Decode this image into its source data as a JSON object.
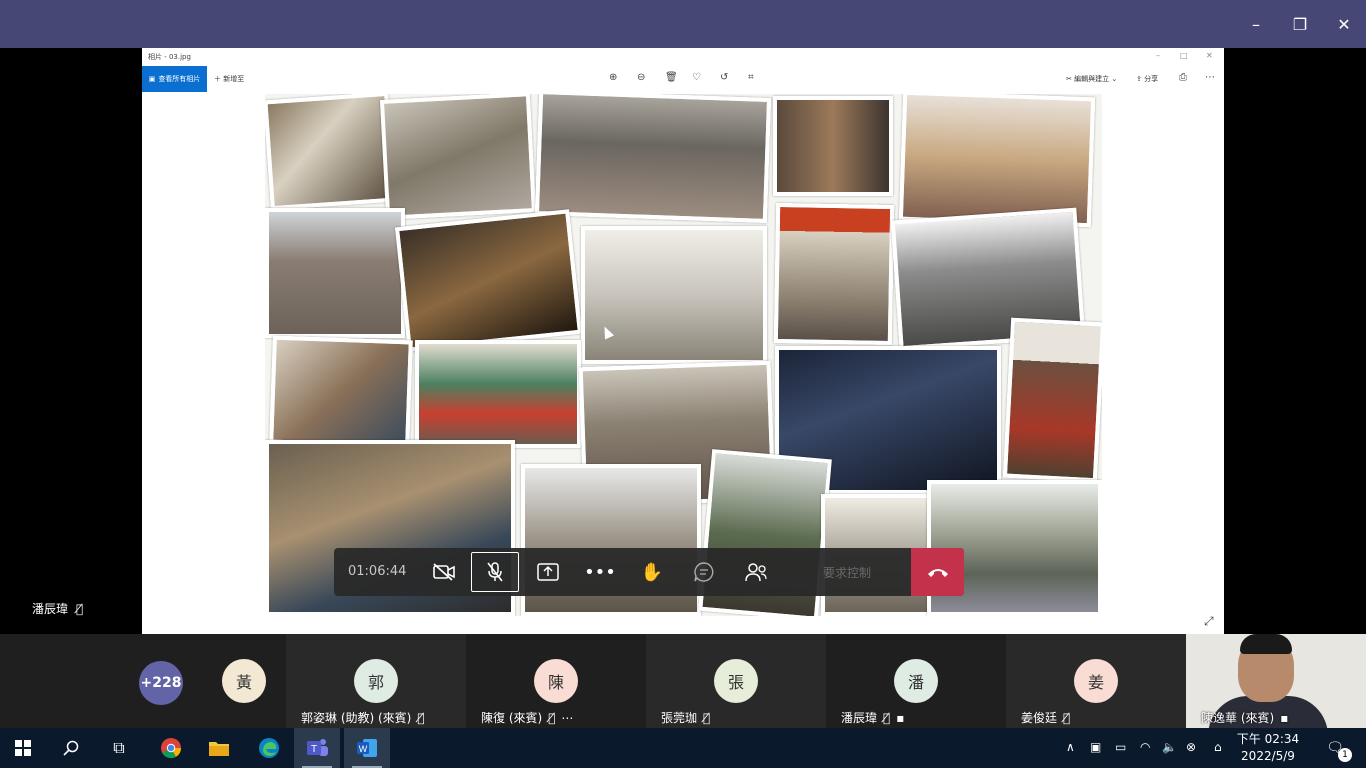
{
  "window": {
    "minimize_glyph": "–",
    "maximize_glyph": "❐",
    "close_glyph": "✕"
  },
  "photos_app": {
    "title": "相片 - 03.jpg",
    "tab_label": "查看所有相片",
    "add_label": "新增至",
    "edit_label": "編輯與建立",
    "share_label": "分享"
  },
  "presenter": {
    "name": "潘辰瑋"
  },
  "call": {
    "timer": "01:06:44",
    "request_control_label": "要求控制"
  },
  "participants": {
    "overflow_count": "+228",
    "items": [
      {
        "initial": "黃",
        "name": "",
        "color": "#f2e8d4"
      },
      {
        "initial": "郭",
        "name": "郭姿琳 (助教) (來賓)",
        "color": "#dfece3"
      },
      {
        "initial": "陳",
        "name": "陳復 (來賓)",
        "color": "#f9dcd3"
      },
      {
        "initial": "張",
        "name": "張莞珈",
        "color": "#e6edd8"
      },
      {
        "initial": "潘",
        "name": "潘辰瑋",
        "color": "#dfece3"
      },
      {
        "initial": "姜",
        "name": "姜俊廷",
        "color": "#f9dcd3"
      },
      {
        "initial": "",
        "name": "陳逸華 (來賓)",
        "color": ""
      }
    ]
  },
  "taskbar": {
    "time": "下午 02:34",
    "date": "2022/5/9",
    "notification_count": "1"
  },
  "colors": {
    "teams_header": "#464775",
    "hangup_red": "#c4314b",
    "photos_accent": "#0a6fd0"
  }
}
